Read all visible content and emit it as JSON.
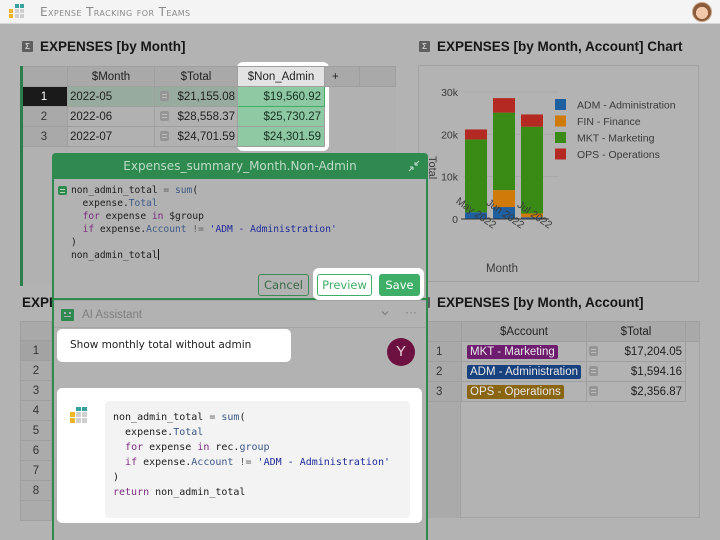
{
  "app": {
    "title": "Expense Tracking for Teams",
    "avatar": "user-photo"
  },
  "months_table": {
    "title": "EXPENSES [by Month]",
    "columns": [
      "",
      "$Month",
      "",
      "$Total",
      "$Non_Admin",
      "+"
    ],
    "rows": [
      {
        "num": "1",
        "month": "2022-05",
        "total": "$21,155.08",
        "non_admin": "$19,560.92"
      },
      {
        "num": "2",
        "month": "2022-06",
        "total": "$28,558.37",
        "non_admin": "$25,730.27"
      },
      {
        "num": "3",
        "month": "2022-07",
        "total": "$24,701.59",
        "non_admin": "$24,301.59"
      }
    ]
  },
  "chart_section": {
    "title": "EXPENSES [by Month, Account] Chart"
  },
  "chart_data": {
    "type": "bar",
    "stacked": true,
    "title": "EXPENSES [by Month, Account] Chart",
    "xlabel": "Month",
    "ylabel": "Total",
    "categories": [
      "May 2022",
      "Jun 2022",
      "Jul 2022"
    ],
    "ylim": [
      0,
      30000
    ],
    "yticks": [
      "0",
      "10k",
      "20k",
      "30k"
    ],
    "ytick_values": [
      0,
      10000,
      20000,
      30000
    ],
    "legend_position": "right",
    "series": [
      {
        "name": "ADM - Administration",
        "color": "#1f5fa0",
        "values": [
          1594,
          2828,
          400
        ]
      },
      {
        "name": "FIN - Finance",
        "color": "#d07a0a",
        "values": [
          0,
          4000,
          900
        ]
      },
      {
        "name": "MKT - Marketing",
        "color": "#3a8a16",
        "values": [
          17204,
          18300,
          20500
        ]
      },
      {
        "name": "OPS - Operations",
        "color": "#b42a22",
        "values": [
          2357,
          3430,
          2900
        ]
      }
    ]
  },
  "bottom_left": {
    "title_partial": "EXPE",
    "row_nums": [
      "1",
      "2",
      "3",
      "4",
      "5",
      "6",
      "7",
      "8"
    ]
  },
  "account_table": {
    "title": "EXPENSES [by Month, Account]",
    "columns": [
      "",
      "$Account",
      "",
      "$Total"
    ],
    "rows": [
      {
        "num": "1",
        "account": "MKT - Marketing",
        "chip_color": "#6e1c6e",
        "total": "$17,204.05"
      },
      {
        "num": "2",
        "account": "ADM - Administration",
        "chip_color": "#16407e",
        "total": "$1,594.16"
      },
      {
        "num": "3",
        "account": "OPS - Operations",
        "chip_color": "#8a6512",
        "total": "$2,356.87"
      }
    ]
  },
  "formula_editor": {
    "title": "Expenses_summary_Month.Non-Admin",
    "code_lines": [
      "non_admin_total = sum(",
      "  expense.Total",
      "  for expense in $group",
      "  if expense.Account != 'ADM - Administration'",
      ")",
      "non_admin_total"
    ],
    "cancel_label": "Cancel",
    "preview_label": "Preview",
    "save_label": "Save"
  },
  "ai_assistant": {
    "title": "AI Assistant",
    "user_message": "Show monthly total without admin",
    "user_initial": "Y",
    "response_code_lines": [
      "non_admin_total = sum(",
      "  expense.Total",
      "  for expense in rec.group",
      "  if expense.Account != 'ADM - Administration'",
      ")",
      "return non_admin_total"
    ]
  }
}
